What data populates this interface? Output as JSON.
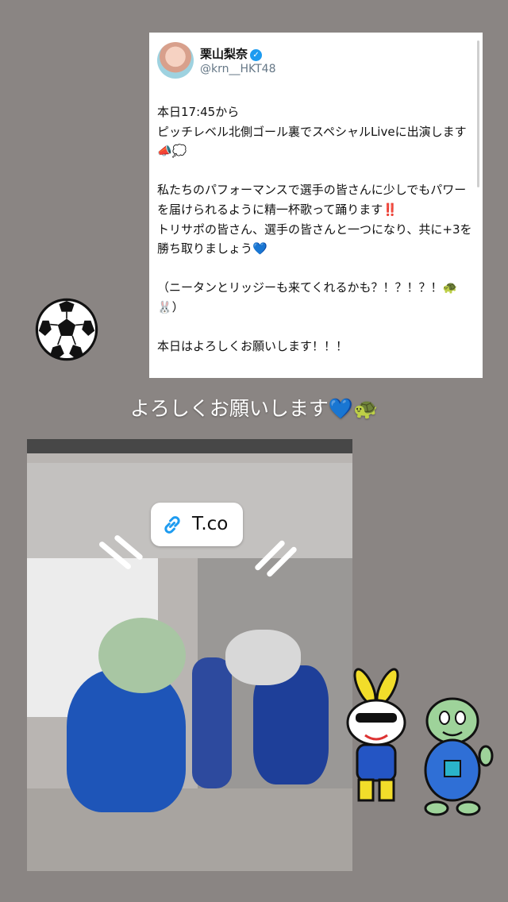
{
  "tweet": {
    "name": "栗山梨奈",
    "handle": "@krn__HKT48",
    "verified_icon": "verified-badge-icon",
    "body": "本日17:45から\nピッチレベル北側ゴール裏でスペシャルLiveに出演します📣💭\n\n私たちのパフォーマンスで選手の皆さんに少しでもパワーを届けられるように精一杯歌って踊ります‼️\nトリサポの皆さん、選手の皆さんと一つになり、共に+3を勝ち取りましょう💙\n\n（ニータンとリッジーも来てくれるかも？！？！？！🐢🐰）\n\n本日はよろしくお願いします！！！"
  },
  "caption": "よろしくお願いします💙🐢",
  "link_sticker": {
    "label": "T.co",
    "icon": "link-icon"
  },
  "colors": {
    "background": "#8a8583",
    "verified": "#1d9bf0",
    "link": "#1d9bf0"
  }
}
